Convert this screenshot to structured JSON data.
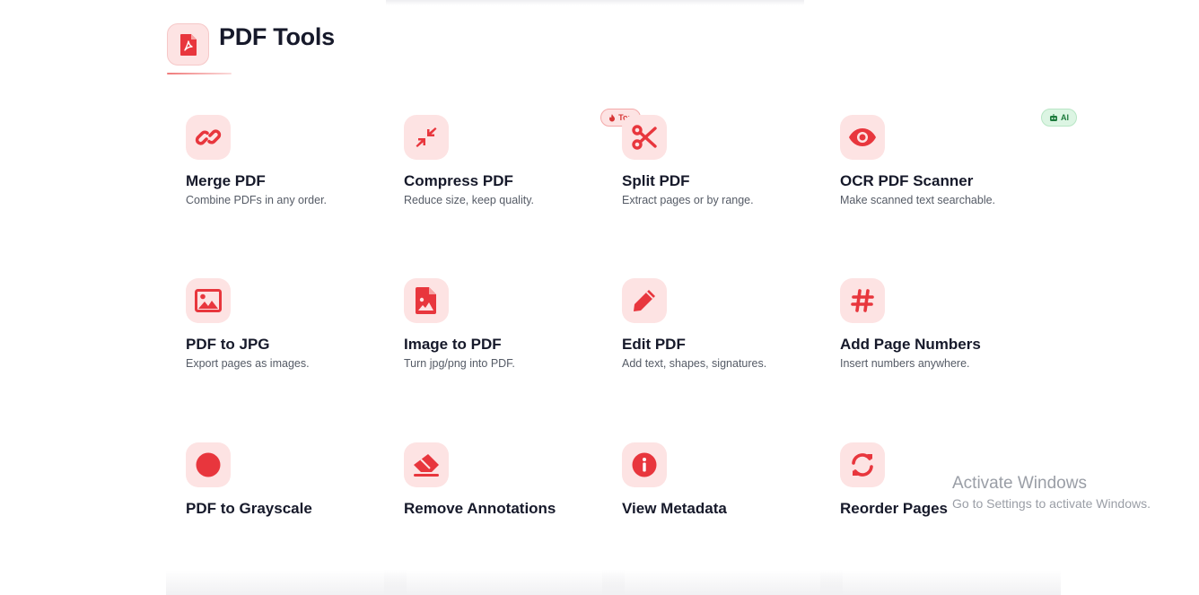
{
  "header": {
    "title": "PDF Tools",
    "icon": "pdf-file-icon"
  },
  "colors": {
    "accent": "#e8363d",
    "icon_bg": "#fde3e3",
    "ai_badge_bg": "#dcf5e3",
    "ai_badge_text": "#1d7a3c"
  },
  "tools": [
    {
      "title": "Merge PDF",
      "desc": "Combine PDFs in any order.",
      "icon": "link-icon"
    },
    {
      "title": "Compress PDF",
      "desc": "Reduce size, keep quality.",
      "icon": "compress-arrows-icon",
      "badge": "Top",
      "badge_icon": "fire-icon"
    },
    {
      "title": "Split PDF",
      "desc": "Extract pages or by range.",
      "icon": "scissors-icon"
    },
    {
      "title": "OCR PDF Scanner",
      "desc": "Make scanned text searchable.",
      "icon": "eye-icon",
      "badge": "AI",
      "badge_icon": "robot-icon"
    },
    {
      "title": "PDF to JPG",
      "desc": "Export pages as images.",
      "icon": "image-icon"
    },
    {
      "title": "Image to PDF",
      "desc": "Turn jpg/png into PDF.",
      "icon": "file-image-icon"
    },
    {
      "title": "Edit PDF",
      "desc": "Add text, shapes, signatures.",
      "icon": "pencil-icon"
    },
    {
      "title": "Add Page Numbers",
      "desc": "Insert numbers anywhere.",
      "icon": "hashtag-icon"
    },
    {
      "title": "PDF to Grayscale",
      "desc": "",
      "icon": "circle-icon"
    },
    {
      "title": "Remove Annotations",
      "desc": "",
      "icon": "eraser-icon"
    },
    {
      "title": "View Metadata",
      "desc": "",
      "icon": "info-icon"
    },
    {
      "title": "Reorder Pages",
      "desc": "",
      "icon": "refresh-icon"
    }
  ],
  "watermark": {
    "title": "Activate Windows",
    "subtitle": "Go to Settings to activate Windows."
  }
}
